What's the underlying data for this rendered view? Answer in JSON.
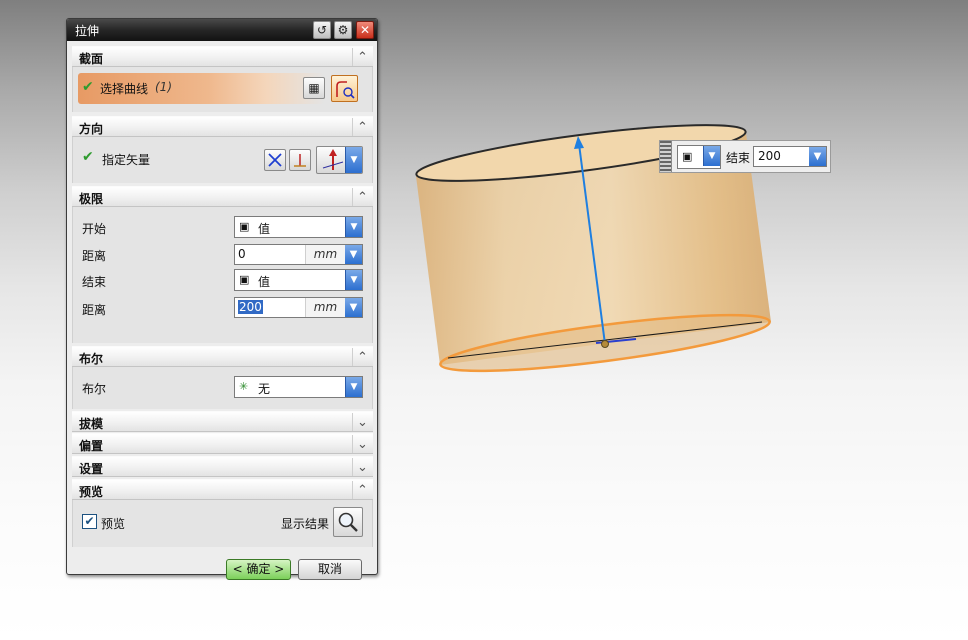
{
  "dialog": {
    "title": "拉伸",
    "titlebar_buttons": [
      "reset-icon",
      "gear-icon",
      "close-icon"
    ],
    "sections": {
      "section": {
        "title": "截面",
        "select_curve_label": "选择曲线",
        "select_curve_count": "(1)"
      },
      "direction": {
        "title": "方向",
        "specify_vector_label": "指定矢量"
      },
      "limits": {
        "title": "极限",
        "start_label": "开始",
        "start_value": "值",
        "start_distance_label": "距离",
        "start_distance": "0",
        "end_label": "结束",
        "end_value": "值",
        "end_distance_label": "距离",
        "end_distance": "200",
        "unit": "mm"
      },
      "boolean": {
        "title": "布尔",
        "boolean_label": "布尔",
        "boolean_value": "无"
      },
      "draft": {
        "title": "拔模"
      },
      "offset": {
        "title": "偏置"
      },
      "settings": {
        "title": "设置"
      },
      "preview": {
        "title": "预览",
        "preview_checkbox_label": "预览",
        "preview_checked": true,
        "show_result_label": "显示结果"
      }
    },
    "buttons": {
      "ok": "< 确定 >",
      "cancel": "取消"
    }
  },
  "graphics": {
    "floating_toolbar": {
      "end_label": "结束",
      "end_value": "200"
    }
  },
  "colors": {
    "selection_accent": "#e79a64",
    "check_green": "#2e9b2e",
    "dropdown_blue": "#2c6fd0",
    "cylinder_fill": "#e8c48f",
    "cylinder_edge": "#f39a3c",
    "vector_arrow": "#1f7fe0"
  }
}
